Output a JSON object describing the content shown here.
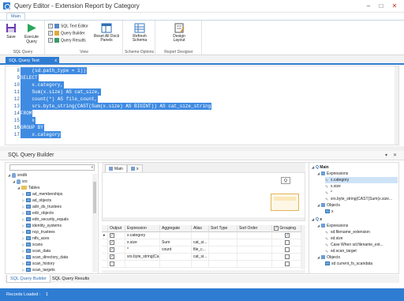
{
  "window": {
    "title": "Query Editor - Extension Report by Category",
    "controls": [
      "–",
      "□",
      "✕"
    ]
  },
  "ribbon": {
    "tab": "Main",
    "groups": [
      {
        "label": "SQL Query",
        "buttons": [
          "Save",
          "Execute Query"
        ]
      },
      {
        "label": "View",
        "toggles": [
          "SQL Text Editor",
          "Query Builder",
          "Query Results"
        ],
        "buttons": [
          "Reset All Dock Panels"
        ]
      },
      {
        "label": "Scheme Options",
        "buttons": [
          "Refresh Schema"
        ]
      },
      {
        "label": "Report Designer",
        "buttons": [
          "Design Layout"
        ]
      }
    ],
    "icons": {
      "save": "save-icon",
      "execute": "play-icon",
      "reset": "dock-panels-icon",
      "refresh": "refresh-schema-icon",
      "design": "design-layout-icon"
    }
  },
  "editor": {
    "tab": "SQL Query Text",
    "tab_close": "x",
    "lines": [
      {
        "n": "8",
        "text": "    (sd.path_type = 1))"
      },
      {
        "n": "9",
        "text": "SELECT"
      },
      {
        "n": "10",
        "text": "    x.category,"
      },
      {
        "n": "11",
        "text": "    Sum(x.size) AS cat_size,"
      },
      {
        "n": "12",
        "text": "    count(*) AS file_count,"
      },
      {
        "n": "13",
        "text": "    srs.byte_string(CAST(Sum(x.size) AS BIGINT)) AS cat_size_string"
      },
      {
        "n": "14",
        "text": "FROM"
      },
      {
        "n": "15",
        "text": "    x"
      },
      {
        "n": "16",
        "text": "GROUP BY"
      },
      {
        "n": "17",
        "text": "    x.category"
      }
    ]
  },
  "query_builder": {
    "title": "SQL Query Builder",
    "title_controls": [
      "▾",
      "✕"
    ],
    "search_clear": "x",
    "tree": [
      {
        "label": "srsdb",
        "level": 0,
        "kind": "db",
        "expanded": true
      },
      {
        "label": "srs",
        "level": 1,
        "kind": "db",
        "expanded": true
      },
      {
        "label": "Tables",
        "level": 2,
        "kind": "folder",
        "expanded": true
      },
      {
        "label": "ad_memberships",
        "level": 3,
        "kind": "table"
      },
      {
        "label": "ad_objects",
        "level": 3,
        "kind": "table"
      },
      {
        "label": "adir_ds_trustees",
        "level": 3,
        "kind": "table"
      },
      {
        "label": "edir_objects",
        "level": 3,
        "kind": "table"
      },
      {
        "label": "edir_security_equals",
        "level": 3,
        "kind": "table"
      },
      {
        "label": "identity_systems",
        "level": 3,
        "kind": "table"
      },
      {
        "label": "ncp_trustees",
        "level": 3,
        "kind": "table"
      },
      {
        "label": "ntfs_aces",
        "level": 3,
        "kind": "table"
      },
      {
        "label": "scans",
        "level": 3,
        "kind": "table"
      },
      {
        "label": "scan_data",
        "level": 3,
        "kind": "table"
      },
      {
        "label": "scan_directory_data",
        "level": 3,
        "kind": "table"
      },
      {
        "label": "scan_history",
        "level": 3,
        "kind": "table"
      },
      {
        "label": "scan_targets",
        "level": 3,
        "kind": "table"
      }
    ],
    "design_tabs": [
      "Main",
      "x"
    ],
    "zoom_label": "Q",
    "grid": {
      "columns": [
        "",
        "Output",
        "Expression",
        "Aggregate",
        "Alias",
        "Sort Type",
        "Sort Order",
        "Grouping"
      ],
      "rows": [
        {
          "output": true,
          "expression": "x.category",
          "aggregate": "",
          "alias": "",
          "sort_type": "",
          "sort_order": "",
          "grouping": true
        },
        {
          "output": true,
          "expression": "x.size",
          "aggregate": "Sum",
          "alias": "cat_si...",
          "sort_type": "",
          "sort_order": "",
          "grouping": false
        },
        {
          "output": true,
          "expression": "*",
          "aggregate": "count",
          "alias": "file_c...",
          "sort_type": "",
          "sort_order": "",
          "grouping": false
        },
        {
          "output": true,
          "expression": "srs.byte_string(Ca...",
          "aggregate": "",
          "alias": "cat_si...",
          "sort_type": "",
          "sort_order": "",
          "grouping": false
        },
        {
          "output": false,
          "expression": "",
          "aggregate": "",
          "alias": "",
          "sort_type": "",
          "sort_order": "",
          "grouping": false
        }
      ]
    },
    "structure": [
      {
        "label": "Main",
        "level": 0,
        "kind": "query"
      },
      {
        "label": "Expressions",
        "level": 1,
        "kind": "folder"
      },
      {
        "label": "x.category",
        "level": 2,
        "kind": "expr",
        "selected": true
      },
      {
        "label": "x.size",
        "level": 2,
        "kind": "expr"
      },
      {
        "label": "*",
        "level": 2,
        "kind": "expr"
      },
      {
        "label": "srs.byte_string(CAST(Sum(x.size...",
        "level": 2,
        "kind": "expr"
      },
      {
        "label": "Objects",
        "level": 1,
        "kind": "folder"
      },
      {
        "label": "x",
        "level": 2,
        "kind": "table"
      },
      {
        "label": "x",
        "level": 0,
        "kind": "query"
      },
      {
        "label": "Expressions",
        "level": 1,
        "kind": "folder"
      },
      {
        "label": "sd.filename_extension",
        "level": 2,
        "kind": "expr"
      },
      {
        "label": "sd.size",
        "level": 2,
        "kind": "expr"
      },
      {
        "label": "Case When sd.filename_ext...",
        "level": 2,
        "kind": "expr"
      },
      {
        "label": "sd.scan_target",
        "level": 2,
        "kind": "expr"
      },
      {
        "label": "Objects",
        "level": 1,
        "kind": "folder"
      },
      {
        "label": "sd current_fs_scandata",
        "level": 2,
        "kind": "table"
      }
    ]
  },
  "bottom_tabs": [
    "SQL Query Builder",
    "SQL Query Results"
  ],
  "status": {
    "label": "Records Loaded :",
    "value": "1"
  },
  "colors": {
    "accent": "#2f7dd3",
    "selection": "#3f8be2",
    "tree_selection": "#cfe3f7"
  }
}
